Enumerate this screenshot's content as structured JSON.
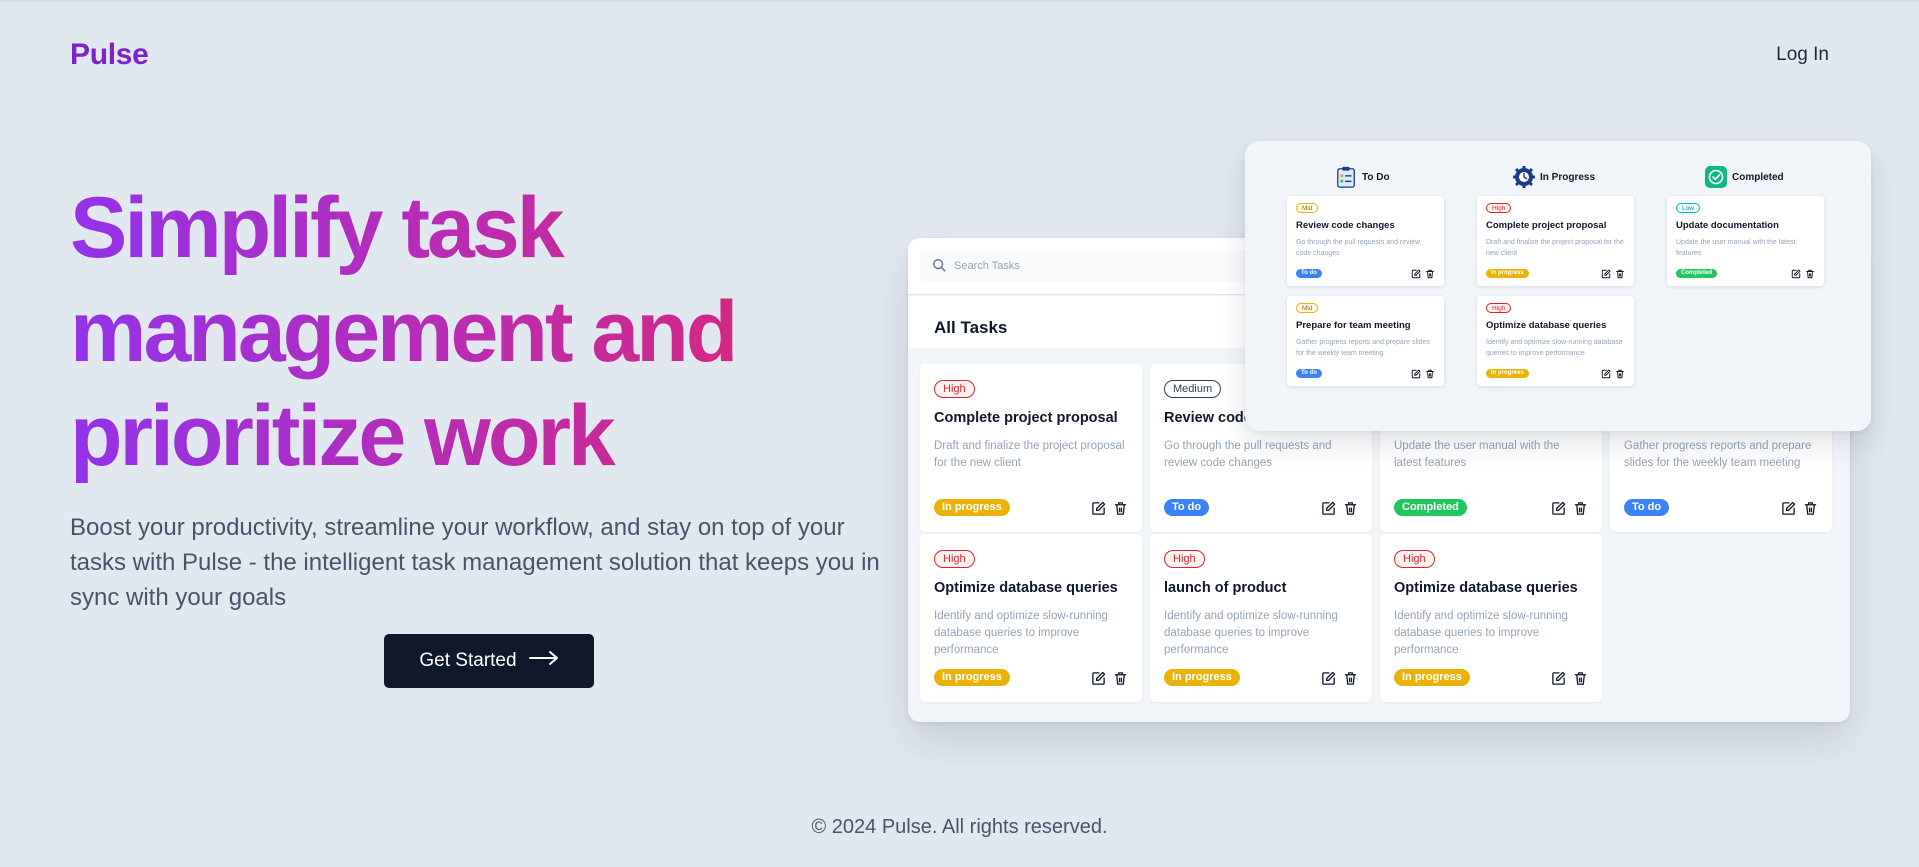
{
  "header": {
    "logo": "Pulse",
    "login_label": "Log In"
  },
  "hero": {
    "title_line1": "Simplify task",
    "title_line2": "management and",
    "title_line3": "prioritize work",
    "subtitle": "Boost your productivity, streamline your workflow, and stay on top of your tasks with Pulse - the intelligent task management solution that keeps you in sync with your goals",
    "cta_label": "Get Started"
  },
  "footer": {
    "copyright": "© 2024 Pulse. All rights reserved."
  },
  "preview": {
    "search_placeholder": "Search Tasks",
    "heading": "All Tasks",
    "cards": [
      {
        "priority": "High",
        "title": "Complete project proposal",
        "desc": "Draft and finalize the project proposal for the new client",
        "status": "In progress"
      },
      {
        "priority": "Medium",
        "title": "Review code",
        "desc": "Go through the pull requests and review code changes",
        "status": "To do"
      },
      {
        "desc": "Update the user manual with the latest features",
        "status": "Completed"
      },
      {
        "desc": "Gather progress reports and prepare slides for the weekly team meeting",
        "status": "To do"
      },
      {
        "priority": "High",
        "title": "Optimize database queries",
        "desc": "Identify and optimize slow-running database queries to improve performance",
        "status": "In progress"
      },
      {
        "priority": "High",
        "title": "launch of product",
        "desc": "Identify and optimize slow-running database queries to improve performance",
        "status": "In progress"
      },
      {
        "priority": "High",
        "title": "Optimize database queries",
        "desc": "Identify and optimize slow-running database queries to improve performance",
        "status": "In progress"
      }
    ]
  },
  "kanban": {
    "columns": [
      {
        "label": "To Do",
        "icon": "clipboard-checklist-icon"
      },
      {
        "label": "In Progress",
        "icon": "gear-progress-icon"
      },
      {
        "label": "Completed",
        "icon": "check-circle-icon"
      }
    ],
    "cards": [
      {
        "priority": "Mid",
        "title": "Review code changes",
        "desc": "Go through the pull requests and review code changes",
        "status": "To do"
      },
      {
        "priority": "Mid",
        "title": "Prepare for team meeting",
        "desc": "Gather progress reports and prepare slides for the weekly team meeting",
        "status": "To do"
      },
      {
        "priority": "High",
        "title": "Complete project proposal",
        "desc": "Draft and finalize the project proposal for the new client",
        "status": "In progress"
      },
      {
        "priority": "High",
        "title": "Optimize database queries",
        "desc": "Identify and optimize slow-running database queries to improve performance",
        "status": "In progress"
      },
      {
        "priority": "Low",
        "title": "Update documentation",
        "desc": "Update the user manual with the latest features",
        "status": "Completed"
      }
    ]
  },
  "colors": {
    "brand": "#7e22ce",
    "gradient_start": "#9333ea",
    "gradient_end": "#db2777",
    "cta_bg": "#0f172a",
    "status_in_progress": "#eab308",
    "status_todo": "#3b82f6",
    "status_completed": "#22c55e",
    "priority_high": "#dc2626"
  }
}
